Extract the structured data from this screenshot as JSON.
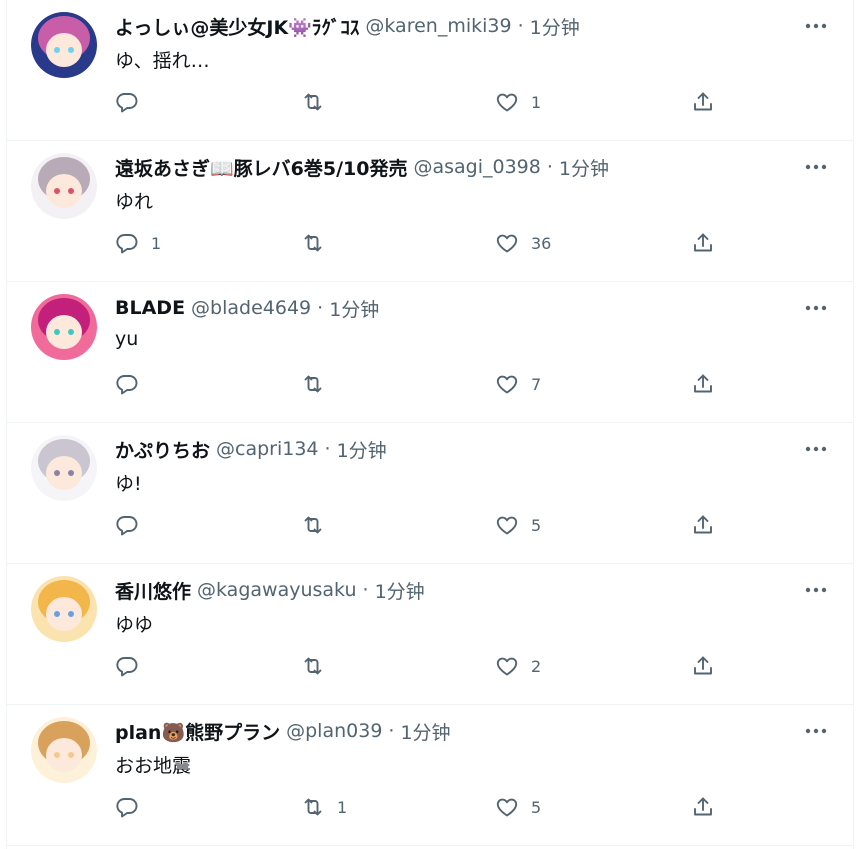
{
  "tweets": [
    {
      "name": "よっしぃ@美少女JK👾ﾗｸﾞｺｽ",
      "handle": "@karen_miki39",
      "sep": "·",
      "time": "1分钟",
      "text": "ゆ、揺れ…",
      "reply_count": "",
      "retweet_count": "",
      "like_count": "1",
      "avatar_colors": [
        "#2a3a8a",
        "#c95ea8",
        "#6fd0f0"
      ]
    },
    {
      "name": "遠坂あさぎ📖豚レバ6巻5/10発売",
      "handle": "@asagi_0398",
      "sep": "·",
      "time": "1分钟",
      "text": "ゆれ",
      "reply_count": "1",
      "retweet_count": "",
      "like_count": "36",
      "avatar_colors": [
        "#f3f1f4",
        "#b8aab6",
        "#d9546a"
      ]
    },
    {
      "name": "BLADE",
      "handle": "@blade4649",
      "sep": "·",
      "time": "1分钟",
      "text": "yu",
      "reply_count": "",
      "retweet_count": "",
      "like_count": "7",
      "avatar_colors": [
        "#f06a9a",
        "#c2207a",
        "#3fc8c0"
      ]
    },
    {
      "name": "かぷりちお",
      "handle": "@capri134",
      "sep": "·",
      "time": "1分钟",
      "text": "ゆ!",
      "reply_count": "",
      "retweet_count": "",
      "like_count": "5",
      "avatar_colors": [
        "#f5f5f7",
        "#c9c6d2",
        "#8a83a8"
      ]
    },
    {
      "name": "香川悠作",
      "handle": "@kagawayusaku",
      "sep": "·",
      "time": "1分钟",
      "text": "ゆゆ",
      "reply_count": "",
      "retweet_count": "",
      "like_count": "2",
      "avatar_colors": [
        "#fbe3b0",
        "#f2b64a",
        "#6aa0e0"
      ]
    },
    {
      "name": "plan🐻熊野プラン",
      "handle": "@plan039",
      "sep": "·",
      "time": "1分钟",
      "text": "おお地震",
      "reply_count": "",
      "retweet_count": "1",
      "like_count": "5",
      "avatar_colors": [
        "#fdf1da",
        "#d9a25c",
        "#f4c98a"
      ]
    }
  ],
  "icons": {
    "reply": "reply-icon",
    "retweet": "retweet-icon",
    "like": "like-icon",
    "share": "share-icon",
    "more": "more-icon"
  },
  "colors": {
    "text_primary": "#0f1419",
    "text_secondary": "#536471",
    "divider": "#eff3f4"
  }
}
